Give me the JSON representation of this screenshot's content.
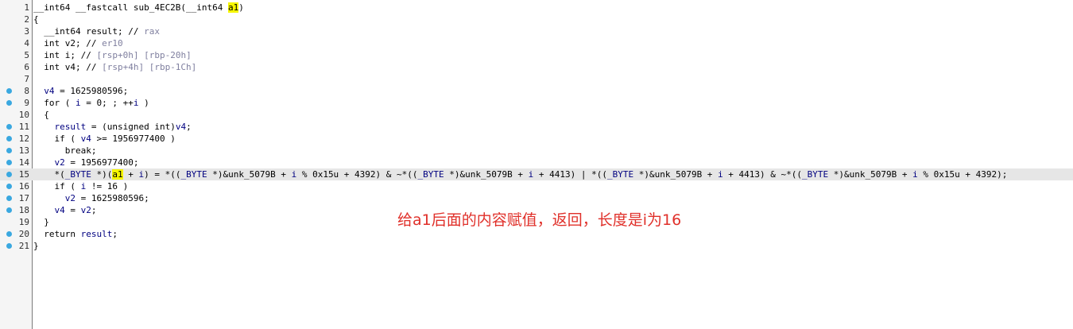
{
  "colors": {
    "gutter_bg": "#f5f5f5",
    "breakpoint_dot": "#3aa8e0",
    "highlight_line": "#e6e6e6",
    "identifier_highlight": "#f5f500",
    "annotation": "#e0302a"
  },
  "code_lines": [
    {
      "num": "1",
      "dot": false,
      "hl": false,
      "tokens": [
        {
          "t": "__int64 __fastcall sub_4EC2B(__int64 ",
          "c": "n"
        },
        {
          "t": "a1",
          "c": "hl"
        },
        {
          "t": ")",
          "c": "n"
        }
      ]
    },
    {
      "num": "2",
      "dot": false,
      "hl": false,
      "tokens": [
        {
          "t": "{",
          "c": "n"
        }
      ]
    },
    {
      "num": "3",
      "dot": false,
      "hl": false,
      "tokens": [
        {
          "t": "  __int64 result; // ",
          "c": "n"
        },
        {
          "t": "rax",
          "c": "c"
        }
      ]
    },
    {
      "num": "4",
      "dot": false,
      "hl": false,
      "tokens": [
        {
          "t": "  int v2; // ",
          "c": "n"
        },
        {
          "t": "er10",
          "c": "c"
        }
      ]
    },
    {
      "num": "5",
      "dot": false,
      "hl": false,
      "tokens": [
        {
          "t": "  int i; // ",
          "c": "n"
        },
        {
          "t": "[rsp+0h] [rbp-20h]",
          "c": "c"
        }
      ]
    },
    {
      "num": "6",
      "dot": false,
      "hl": false,
      "tokens": [
        {
          "t": "  int v4; // ",
          "c": "n"
        },
        {
          "t": "[rsp+4h] [rbp-1Ch]",
          "c": "c"
        }
      ]
    },
    {
      "num": "7",
      "dot": false,
      "hl": false,
      "tokens": [
        {
          "t": "",
          "c": "n"
        }
      ]
    },
    {
      "num": "8",
      "dot": true,
      "hl": false,
      "tokens": [
        {
          "t": "  ",
          "c": "n"
        },
        {
          "t": "v4",
          "c": "v"
        },
        {
          "t": " = 1625980596;",
          "c": "n"
        }
      ]
    },
    {
      "num": "9",
      "dot": true,
      "hl": false,
      "tokens": [
        {
          "t": "  for ( ",
          "c": "n"
        },
        {
          "t": "i",
          "c": "v"
        },
        {
          "t": " = 0; ; ++",
          "c": "n"
        },
        {
          "t": "i",
          "c": "v"
        },
        {
          "t": " )",
          "c": "n"
        }
      ]
    },
    {
      "num": "10",
      "dot": false,
      "hl": false,
      "tokens": [
        {
          "t": "  {",
          "c": "n"
        }
      ]
    },
    {
      "num": "11",
      "dot": true,
      "hl": false,
      "tokens": [
        {
          "t": "    ",
          "c": "n"
        },
        {
          "t": "result",
          "c": "v"
        },
        {
          "t": " = (unsigned int)",
          "c": "n"
        },
        {
          "t": "v4",
          "c": "v"
        },
        {
          "t": ";",
          "c": "n"
        }
      ]
    },
    {
      "num": "12",
      "dot": true,
      "hl": false,
      "tokens": [
        {
          "t": "    if ( ",
          "c": "n"
        },
        {
          "t": "v4",
          "c": "v"
        },
        {
          "t": " >= 1956977400 )",
          "c": "n"
        }
      ]
    },
    {
      "num": "13",
      "dot": true,
      "hl": false,
      "tokens": [
        {
          "t": "      break;",
          "c": "n"
        }
      ]
    },
    {
      "num": "14",
      "dot": true,
      "hl": false,
      "tokens": [
        {
          "t": "    ",
          "c": "n"
        },
        {
          "t": "v2",
          "c": "v"
        },
        {
          "t": " = 1956977400;",
          "c": "n"
        }
      ]
    },
    {
      "num": "15",
      "dot": true,
      "hl": true,
      "tokens": [
        {
          "t": "    *(",
          "c": "n"
        },
        {
          "t": "_BYTE",
          "c": "v"
        },
        {
          "t": " *)(",
          "c": "n"
        },
        {
          "t": "a1",
          "c": "hl"
        },
        {
          "t": " + ",
          "c": "n"
        },
        {
          "t": "i",
          "c": "v"
        },
        {
          "t": ") = *((",
          "c": "n"
        },
        {
          "t": "_BYTE",
          "c": "v"
        },
        {
          "t": " *)&unk_5079B + ",
          "c": "n"
        },
        {
          "t": "i",
          "c": "v"
        },
        {
          "t": " % 0x15u + 4392) & ~*((",
          "c": "n"
        },
        {
          "t": "_BYTE",
          "c": "v"
        },
        {
          "t": " *)&unk_5079B + ",
          "c": "n"
        },
        {
          "t": "i",
          "c": "v"
        },
        {
          "t": " + 4413) | *((",
          "c": "n"
        },
        {
          "t": "_BYTE",
          "c": "v"
        },
        {
          "t": " *)&unk_5079B + ",
          "c": "n"
        },
        {
          "t": "i",
          "c": "v"
        },
        {
          "t": " + 4413) & ~*((",
          "c": "n"
        },
        {
          "t": "_BYTE",
          "c": "v"
        },
        {
          "t": " *)&unk_5079B + ",
          "c": "n"
        },
        {
          "t": "i",
          "c": "v"
        },
        {
          "t": " % 0x15u + 4392);",
          "c": "n"
        }
      ]
    },
    {
      "num": "16",
      "dot": true,
      "hl": false,
      "tokens": [
        {
          "t": "    if ( ",
          "c": "n"
        },
        {
          "t": "i",
          "c": "v"
        },
        {
          "t": " != 16 )",
          "c": "n"
        }
      ]
    },
    {
      "num": "17",
      "dot": true,
      "hl": false,
      "tokens": [
        {
          "t": "      ",
          "c": "n"
        },
        {
          "t": "v2",
          "c": "v"
        },
        {
          "t": " = 1625980596;",
          "c": "n"
        }
      ]
    },
    {
      "num": "18",
      "dot": true,
      "hl": false,
      "tokens": [
        {
          "t": "    ",
          "c": "n"
        },
        {
          "t": "v4",
          "c": "v"
        },
        {
          "t": " = ",
          "c": "n"
        },
        {
          "t": "v2",
          "c": "v"
        },
        {
          "t": ";",
          "c": "n"
        }
      ]
    },
    {
      "num": "19",
      "dot": false,
      "hl": false,
      "tokens": [
        {
          "t": "  }",
          "c": "n"
        }
      ]
    },
    {
      "num": "20",
      "dot": true,
      "hl": false,
      "tokens": [
        {
          "t": "  return ",
          "c": "n"
        },
        {
          "t": "result",
          "c": "v"
        },
        {
          "t": ";",
          "c": "n"
        }
      ]
    },
    {
      "num": "21",
      "dot": true,
      "hl": false,
      "tokens": [
        {
          "t": "}",
          "c": "n"
        }
      ]
    }
  ],
  "annotation": "给a1后面的内容赋值，返回，长度是i为16"
}
